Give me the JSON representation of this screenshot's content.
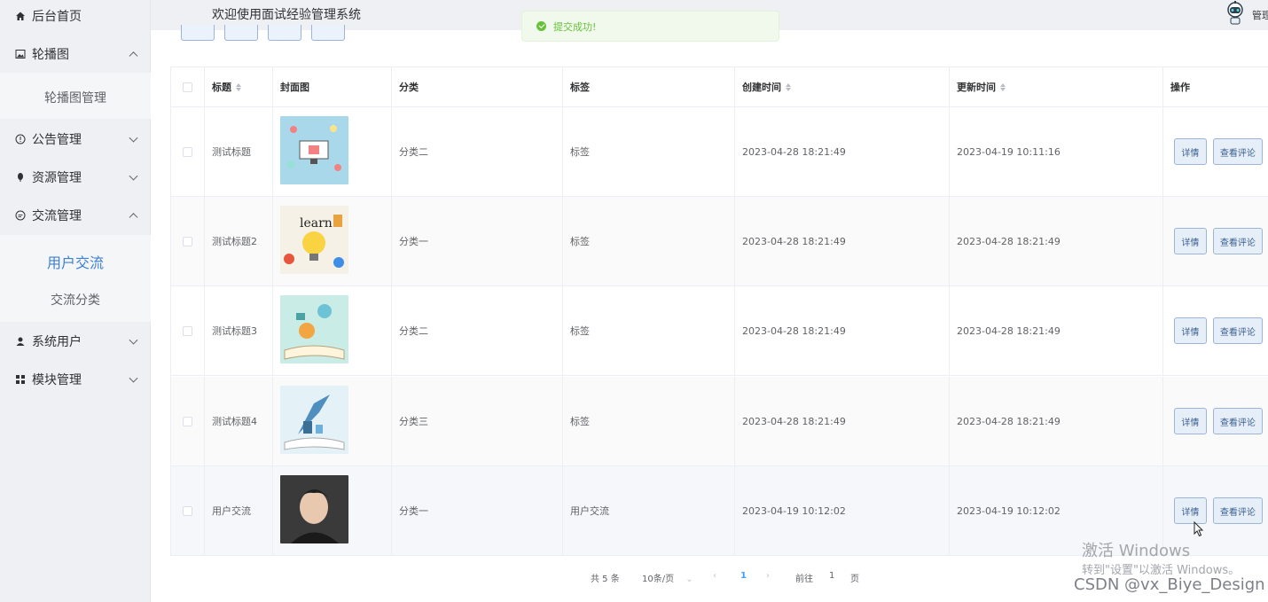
{
  "sidebar": {
    "items": [
      {
        "label": "后台首页",
        "icon": "home-icon"
      },
      {
        "label": "轮播图",
        "icon": "picture-icon"
      },
      {
        "label": "公告管理",
        "icon": "info-icon"
      },
      {
        "label": "资源管理",
        "icon": "pin-icon"
      },
      {
        "label": "交流管理",
        "icon": "chat-icon"
      },
      {
        "label": "系统用户",
        "icon": "user-icon"
      },
      {
        "label": "模块管理",
        "icon": "grid-icon"
      }
    ],
    "carousel_sub": "轮播图管理",
    "exchange_sub": [
      "用户交流",
      "交流分类"
    ]
  },
  "header": {
    "title": "欢迎使用面试经验管理系统",
    "admin": "管理"
  },
  "toast": {
    "message": "提交成功!"
  },
  "table": {
    "headers": [
      "标题",
      "封面图",
      "分类",
      "标签",
      "创建时间",
      "更新时间",
      "操作"
    ],
    "rows": [
      {
        "title": "测试标题",
        "category": "分类二",
        "tag": "标签",
        "created": "2023-04-28 18:21:49",
        "updated": "2023-04-19 10:11:16"
      },
      {
        "title": "测试标题2",
        "category": "分类一",
        "tag": "标签",
        "created": "2023-04-28 18:21:49",
        "updated": "2023-04-28 18:21:49"
      },
      {
        "title": "测试标题3",
        "category": "分类二",
        "tag": "标签",
        "created": "2023-04-28 18:21:49",
        "updated": "2023-04-28 18:21:49"
      },
      {
        "title": "测试标题4",
        "category": "分类三",
        "tag": "标签",
        "created": "2023-04-28 18:21:49",
        "updated": "2023-04-28 18:21:49"
      },
      {
        "title": "用户交流",
        "category": "分类一",
        "tag": "用户交流",
        "created": "2023-04-19 10:12:02",
        "updated": "2023-04-19 10:12:02"
      }
    ],
    "detail_label": "详情",
    "comments_label": "查看评论"
  },
  "pagination": {
    "total": "共 5 条",
    "page_size": "10条/页",
    "current": "1",
    "goto_prefix": "前往",
    "goto_value": "1",
    "goto_suffix": "页"
  },
  "overlay": {
    "activate_title": "激活 Windows",
    "activate_sub": "转到\"设置\"以激活 Windows。",
    "credit": "CSDN @vx_Biye_Design"
  },
  "colors": {
    "accent": "#3c7fd6",
    "success": "#67c23a",
    "sidebar_bg": "#eef0f3"
  }
}
